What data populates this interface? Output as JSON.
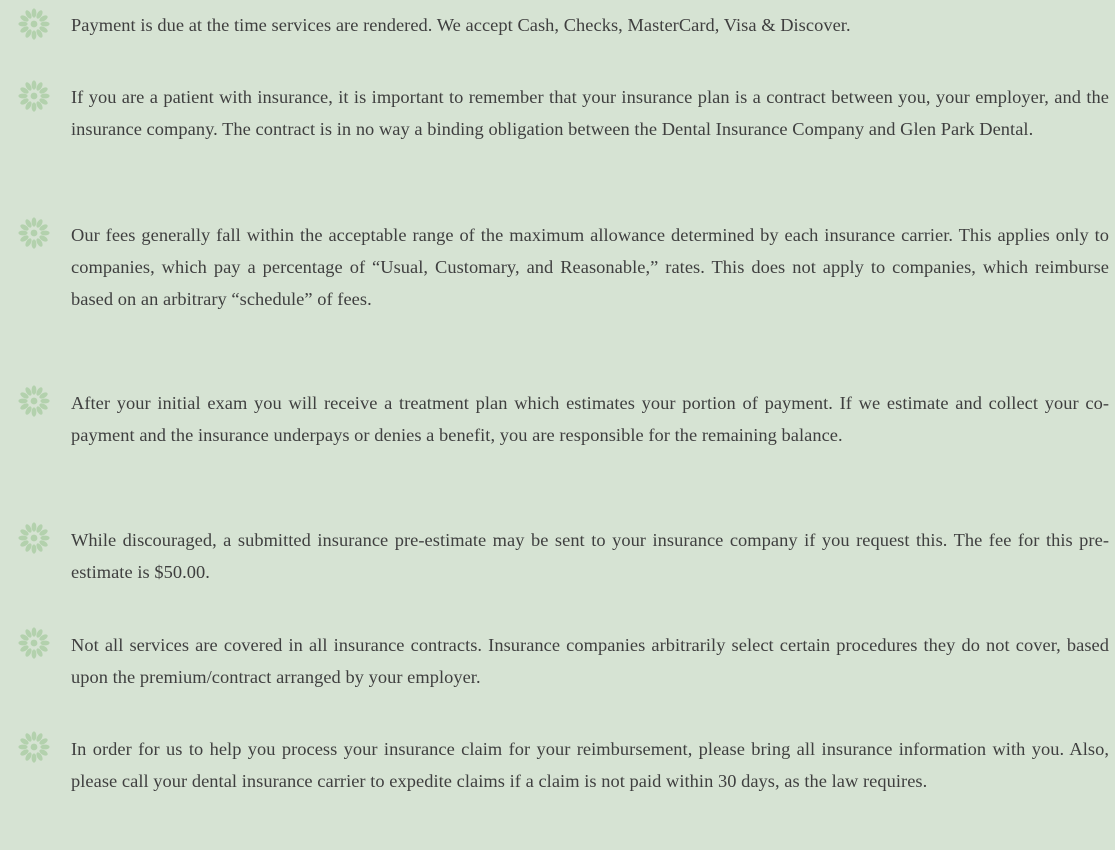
{
  "colors": {
    "background": "#d6e3d3",
    "text": "#3f3f3f",
    "bullet": "#b3d1ad"
  },
  "bullet_icon": "flower-bullet-icon",
  "paragraphs": [
    {
      "text": "Payment is due at the time services are rendered. We accept Cash, Checks, MasterCard, Visa & Discover."
    },
    {
      "text": "If you are a patient with insurance, it is important to remember that your insurance plan is a contract between you, your employer, and the insurance company. The contract is in no way a binding obligation between the Dental Insurance Company and Glen Park Dental."
    },
    {
      "text": "Our fees generally fall within the acceptable range of the maximum allowance determined by each insurance carrier. This applies only to companies, which pay a percentage of “Usual, Customary, and Reasonable,” rates. This does not apply to companies, which reimburse based on an arbitrary “schedule” of fees."
    },
    {
      "text": "After your initial exam you will receive a treatment plan which estimates your portion of payment. If we estimate and collect your co-payment and the insurance underpays or denies a benefit, you are responsible for the remaining balance."
    },
    {
      "text": "While discouraged, a submitted insurance pre-estimate may be sent to your insurance company if you request this. The fee for this pre-estimate is $50.00."
    },
    {
      "text": "Not all services are covered in all insurance contracts. Insurance companies arbitrarily select certain procedures they do not cover, based upon the premium/contract arranged by your employer."
    },
    {
      "text": "In order for us to help you process your insurance claim for your reimbursement, please bring all insurance information with you. Also, please call your dental insurance carrier to expedite claims if a claim is not paid within 30 days, as the law requires."
    }
  ]
}
